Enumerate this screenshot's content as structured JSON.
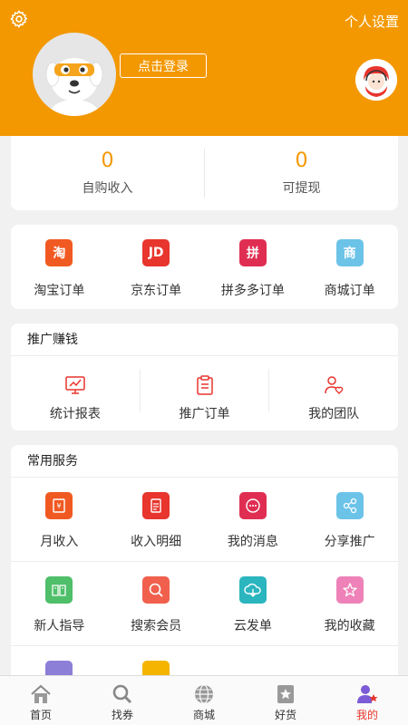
{
  "header": {
    "settings_label": "个人设置",
    "login_button": "点击登录",
    "background_color": "#f39800"
  },
  "income": {
    "self_purchase": {
      "value": "0",
      "label": "自购收入"
    },
    "withdrawable": {
      "value": "0",
      "label": "可提现"
    }
  },
  "orders": [
    {
      "label": "淘宝订单",
      "icon_text": "淘",
      "color": "#f05a22",
      "icon": "taobao-icon"
    },
    {
      "label": "京东订单",
      "icon_text": "JD",
      "color": "#e8352d",
      "icon": "jd-icon"
    },
    {
      "label": "拼多多订单",
      "icon_text": "拼",
      "color": "#e02e52",
      "icon": "pinduoduo-icon"
    },
    {
      "label": "商城订单",
      "icon_text": "商",
      "color": "#6cc3e8",
      "icon": "mall-icon"
    }
  ],
  "promo": {
    "title": "推广赚钱",
    "items": [
      {
        "label": "统计报表",
        "icon": "chart-report-icon"
      },
      {
        "label": "推广订单",
        "icon": "clipboard-icon"
      },
      {
        "label": "我的团队",
        "icon": "team-icon"
      }
    ]
  },
  "services": {
    "title": "常用服务",
    "items": [
      {
        "label": "月收入",
        "icon": "monthly-income-icon",
        "color": "#f05a22"
      },
      {
        "label": "收入明细",
        "icon": "income-detail-icon",
        "color": "#e8352d"
      },
      {
        "label": "我的消息",
        "icon": "message-icon",
        "color": "#e02e52"
      },
      {
        "label": "分享推广",
        "icon": "share-icon",
        "color": "#6cc3e8"
      },
      {
        "label": "新人指导",
        "icon": "guide-book-icon",
        "color": "#4fbf6a"
      },
      {
        "label": "搜索会员",
        "icon": "search-member-icon",
        "color": "#f0604d"
      },
      {
        "label": "云发单",
        "icon": "cloud-icon",
        "color": "#2bb5bf"
      },
      {
        "label": "我的收藏",
        "icon": "star-icon",
        "color": "#ee82b8"
      },
      {
        "label": "",
        "icon": "partial-icon-1",
        "color": "#8c7fd8"
      },
      {
        "label": "",
        "icon": "partial-icon-2",
        "color": "#f5b400"
      }
    ]
  },
  "tabbar": [
    {
      "label": "首页",
      "icon": "home-icon",
      "active": false
    },
    {
      "label": "找券",
      "icon": "search-coupon-icon",
      "active": false
    },
    {
      "label": "商城",
      "icon": "globe-icon",
      "active": false
    },
    {
      "label": "好货",
      "icon": "goods-icon",
      "active": false
    },
    {
      "label": "我的",
      "icon": "profile-icon",
      "active": true
    }
  ],
  "active_color": "#e8352d"
}
